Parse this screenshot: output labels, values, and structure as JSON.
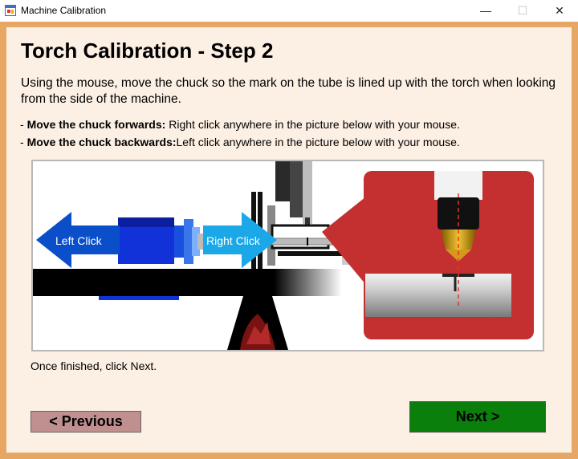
{
  "window": {
    "title": "Machine Calibration",
    "controls": {
      "minimize": "—",
      "maximize": "☐",
      "close": "✕"
    },
    "icon": "app-window-icon"
  },
  "heading": "Torch Calibration - Step 2",
  "intro": "Using the mouse, move the chuck so the mark on the tube is lined up with the torch when looking from the side of the machine.",
  "instructions": [
    {
      "prefix": "- ",
      "label": "Move the chuck forwards:",
      "text": "Right click anywhere in the picture below with your mouse."
    },
    {
      "prefix": "- ",
      "label": "Move the chuck backwards:",
      "text": "Left click anywhere in the picture below with your mouse."
    }
  ],
  "picture": {
    "left_arrow_label": "Left Click",
    "right_arrow_label": "Right Click",
    "colors": {
      "arrow_left": "#0a4fc9",
      "arrow_right": "#1aa8e8",
      "chuck": "#1032d8",
      "inset_bg": "#c42f2f",
      "table": "#000000"
    }
  },
  "finished_text": "Once finished, click Next.",
  "buttons": {
    "previous": "< Previous",
    "next": "Next >"
  }
}
